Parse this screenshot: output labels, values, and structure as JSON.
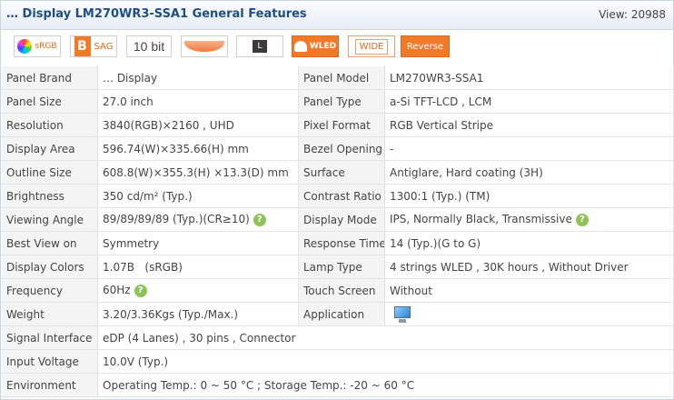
{
  "header": {
    "title": "… Display LM270WR3-SSA1 General Features",
    "views_label": "View:",
    "views_count": "20988"
  },
  "badges": [
    {
      "name": "srgb",
      "label": "sRGB"
    },
    {
      "name": "sag",
      "prefix": "B",
      "label": "SAG"
    },
    {
      "name": "bit",
      "label": "10 bit"
    },
    {
      "name": "screen",
      "label": ""
    },
    {
      "name": "l",
      "label": "L"
    },
    {
      "name": "wled",
      "label": "WLED"
    },
    {
      "name": "wide",
      "label": "WIDE"
    },
    {
      "name": "reverse",
      "label": "Reverse"
    }
  ],
  "specs": {
    "rows": [
      {
        "k1": "Panel Brand",
        "v1": "… Display",
        "k2": "Panel Model",
        "v2": "LM270WR3-SSA1"
      },
      {
        "k1": "Panel Size",
        "v1": "27.0 inch",
        "k2": "Panel Type",
        "v2": "a-Si TFT-LCD , LCM"
      },
      {
        "k1": "Resolution",
        "v1": "3840(RGB)×2160 , UHD",
        "k2": "Pixel Format",
        "v2": "RGB Vertical Stripe"
      },
      {
        "k1": "Display Area",
        "v1": "596.74(W)×335.66(H) mm",
        "k2": "Bezel Opening",
        "v2": "-"
      },
      {
        "k1": "Outline Size",
        "v1": "608.8(W)×355.3(H) ×13.3(D) mm",
        "k2": "Surface",
        "v2": "Antiglare, Hard coating (3H)"
      },
      {
        "k1": "Brightness",
        "v1": "350 cd/m² (Typ.)",
        "k2": "Contrast Ratio",
        "v2": "1300:1 (Typ.) (TM)"
      },
      {
        "k1": "Viewing Angle",
        "v1": "89/89/89/89 (Typ.)(CR≥10)",
        "k2": "Display Mode",
        "v2": "IPS, Normally Black, Transmissive"
      },
      {
        "k1": "Best View on",
        "v1": "Symmetry",
        "k2": "Response Time",
        "v2": "14 (Typ.)(G to G)"
      },
      {
        "k1": "Display Colors",
        "v1": "1.07B   (sRGB)",
        "k2": "Lamp Type",
        "v2": "4 strings WLED , 30K hours , Without Driver"
      },
      {
        "k1": "Frequency",
        "v1": "60Hz",
        "k2": "Touch Screen",
        "v2": "Without"
      },
      {
        "k1": "Weight",
        "v1": "3.20/3.36Kgs (Typ./Max.)",
        "k2": "Application",
        "v2": ""
      }
    ],
    "wide_rows": [
      {
        "k": "Signal Interface",
        "v": "eDP (4 Lanes) , 30 pins , Connector"
      },
      {
        "k": "Input Voltage",
        "v": "10.0V (Typ.)"
      },
      {
        "k": "Environment",
        "v": "Operating Temp.: 0 ~ 50 °C ; Storage Temp.: -20 ~ 60 °C"
      }
    ]
  },
  "help_icon_glyph": "?",
  "icons": {
    "help": "question-icon",
    "application": "monitor-icon"
  },
  "colors": {
    "accent_orange": "#f07a2a",
    "title_blue": "#1f4f82",
    "help_green": "#8fc35a"
  }
}
